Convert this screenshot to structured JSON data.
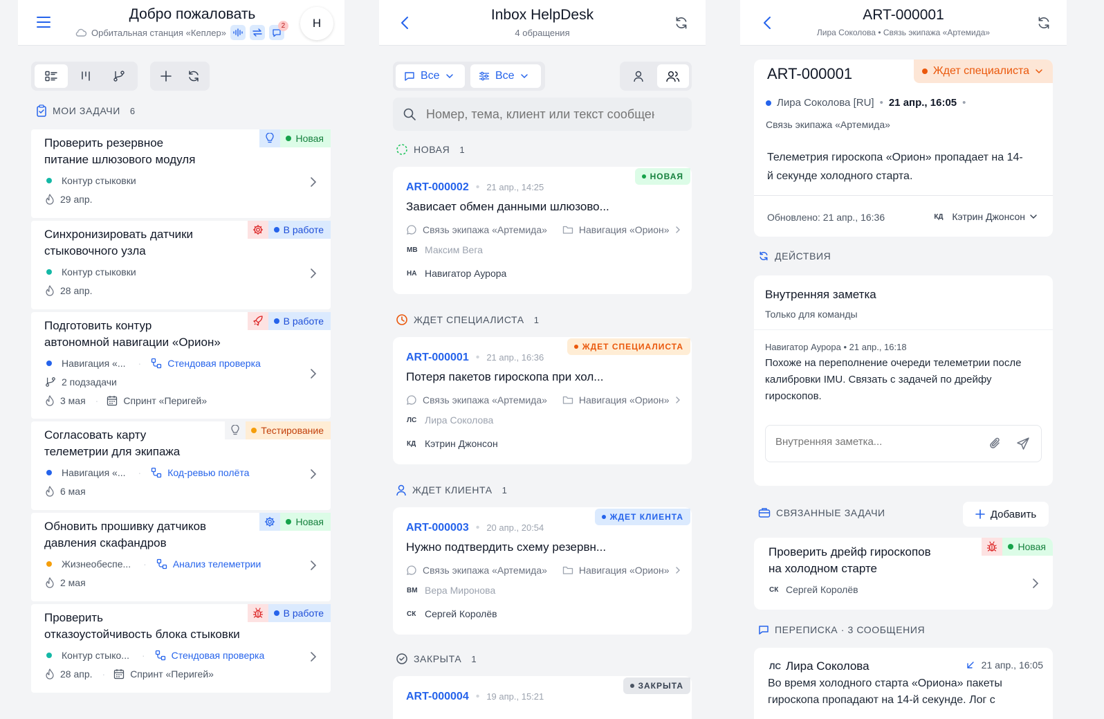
{
  "colors": {
    "accent": "#2563eb",
    "green": "#16a34a",
    "orange": "#ea580c",
    "red": "#dc2626"
  },
  "left": {
    "title": "Добро пожаловать",
    "station": "Орбитальная станция «Кеплер»",
    "notif_count": "2",
    "avatar": "Н",
    "section_title": "Мои задачи",
    "section_count": "6",
    "tasks": [
      {
        "title1": "Проверить резервное",
        "title2": "питание шлюзового модуля",
        "icon": "lightbulb-icon",
        "status": "Новая",
        "area": "Контур стыковки",
        "date": "29 апр."
      },
      {
        "title1": "Синхронизировать датчики",
        "title2": "стыковочного узла",
        "icon": "gear-icon",
        "status": "В работе",
        "area": "Контур стыковки",
        "date": "28 апр."
      },
      {
        "title1": "Подготовить контур",
        "title2": "автономной навигации «Орион»",
        "icon": "rocket-icon",
        "status": "В работе",
        "area": "Навигация «...",
        "link": "Стендовая проверка",
        "subtasks": "2 подзадачи",
        "date": "3 мая",
        "sprint": "Спринт «Перигей»"
      },
      {
        "title1": "Согласовать карту",
        "title2": "телеметрии для экипажа",
        "icon": "lightbulb-icon",
        "status": "Тестирование",
        "area": "Навигация «...",
        "link": "Код-ревью полёта",
        "date": "6 мая"
      },
      {
        "title1": "Обновить прошивку датчиков",
        "title2": "давления скафандров",
        "icon": "gear-icon",
        "status": "Новая",
        "area": "Жизнеобеспе...",
        "link": "Анализ телеметрии",
        "date": "2 мая"
      },
      {
        "title1": "Проверить",
        "title2": "отказоустойчивость блока стыковки",
        "icon": "bug-icon",
        "status": "В работе",
        "area": "Контур стыко...",
        "link": "Стендовая проверка",
        "date": "28 апр.",
        "sprint": "Спринт «Перигей»"
      }
    ]
  },
  "middle": {
    "title": "Inbox HelpDesk",
    "subtitle": "4 обращения",
    "filter1": "Все",
    "filter2": "Все",
    "search_placeholder": "Номер, тема, клиент или текст сообщения",
    "groups": [
      {
        "label": "Новая",
        "count": "1",
        "ticket": {
          "id": "ART-000002",
          "date": "21 апр., 14:25",
          "badge": "Новая",
          "subject": "Зависает обмен данными шлюзово...",
          "channel": "Связь экипажа «Артемида»",
          "project": "Навигация «Орион»",
          "client_ini": "МВ",
          "client": "Максим Вега",
          "agent_ini": "НА",
          "agent": "Навигатор Аурора"
        }
      },
      {
        "label": "Ждет специалиста",
        "count": "1",
        "ticket": {
          "id": "ART-000001",
          "date": "21 апр., 16:36",
          "badge": "Ждет специалиста",
          "subject": "Потеря пакетов гироскопа при хол...",
          "channel": "Связь экипажа «Артемида»",
          "project": "Навигация «Орион»",
          "client_ini": "ЛС",
          "client": "Лира Соколова",
          "agent_ini": "КД",
          "agent": "Кэтрин Джонсон"
        }
      },
      {
        "label": "Ждет клиента",
        "count": "1",
        "ticket": {
          "id": "ART-000003",
          "date": "20 апр., 20:54",
          "badge": "Ждет клиента",
          "subject": "Нужно подтвердить схему резервн...",
          "channel": "Связь экипажа «Артемида»",
          "project": "Навигация «Орион»",
          "client_ini": "ВМ",
          "client": "Вера Миронова",
          "agent_ini": "СК",
          "agent": "Сергей Королёв"
        }
      },
      {
        "label": "Закрыта",
        "count": "1",
        "ticket": {
          "id": "ART-000004",
          "date": "19 апр., 15:21",
          "badge": "Закрыта"
        }
      }
    ]
  },
  "right": {
    "title": "ART-000001",
    "subtitle": "Лира Соколова • Связь экипажа «Артемида»",
    "ticket_id": "ART-000001",
    "status": "Ждет специалиста",
    "author": "Лира Соколова [RU]",
    "created": "21 апр., 16:05",
    "channel": "Связь экипажа «Артемида»",
    "body1": "Телеметрия гироскопа «Орион» пропадает на 14-",
    "body2": "й секунде холодного старта.",
    "updated": "Обновлено: 21 апр., 16:36",
    "assignee_ini": "КД",
    "assignee": "Кэтрин Джонсон",
    "actions_title": "Действия",
    "note_title": "Внутренняя заметка",
    "note_sub": "Только для команды",
    "note_meta": "Навигатор Аурора • 21 апр., 16:18",
    "note_text1": "Похоже на переполнение очереди телеметрии после",
    "note_text2": "калибровки IMU. Связать с задачей по дрейфу",
    "note_text3": "гироскопов.",
    "note_placeholder": "Внутренняя заметка...",
    "linked_title": "Связанные задачи",
    "add_label": "Добавить",
    "linked_task1": "Проверить дрейф гироскопов",
    "linked_task2": "на холодном старте",
    "linked_status": "Новая",
    "linked_ini": "СК",
    "linked_person": "Сергей Королёв",
    "corr_title": "Переписка · 3 сообщения",
    "msg_ini": "ЛС",
    "msg_author": "Лира Соколова",
    "msg_time": "21 апр., 16:05",
    "msg_text1": "Во время холодного старта «Ориона» пакеты",
    "msg_text2": "гироскопа пропадают на 14-й секунде. Лог с"
  }
}
